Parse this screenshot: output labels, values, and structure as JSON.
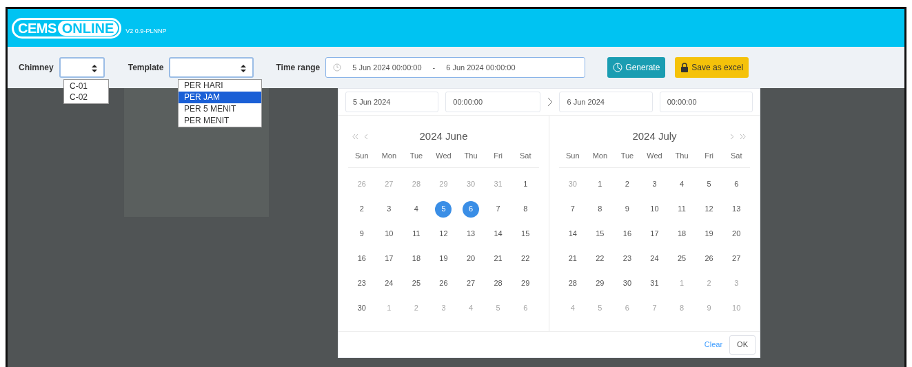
{
  "header": {
    "logo_left": "CEMS",
    "logo_right": "ONLINE",
    "version": "V2 0.9-PLNNP"
  },
  "toolbar": {
    "chimney": {
      "label": "Chimney",
      "options": [
        {
          "label": "C-01",
          "selected": false
        },
        {
          "label": "C-02",
          "selected": false
        }
      ]
    },
    "template": {
      "label": "Template",
      "options": [
        {
          "label": "PER HARI",
          "selected": false
        },
        {
          "label": "PER JAM",
          "selected": true
        },
        {
          "label": "PER 5 MENIT",
          "selected": false
        },
        {
          "label": "PER MENIT",
          "selected": false
        }
      ]
    },
    "time_range": {
      "label": "Time range",
      "start": "5 Jun 2024 00:00:00",
      "separator": "-",
      "end": "6 Jun 2024 00:00:00"
    },
    "buttons": [
      {
        "kind": "generate",
        "label": "Generate"
      },
      {
        "kind": "excel",
        "label": "Save as excel"
      }
    ]
  },
  "picker": {
    "start_date": "5 Jun 2024",
    "start_time": "00:00:00",
    "end_date": "6 Jun 2024",
    "end_time": "00:00:00",
    "months": [
      {
        "title": "2024 June",
        "prev_nav": true,
        "next_nav": false,
        "weekdays": [
          "Sun",
          "Mon",
          "Tue",
          "Wed",
          "Thu",
          "Fri",
          "Sat"
        ],
        "days": [
          {
            "label": "26",
            "muted": true,
            "selected": false
          },
          {
            "label": "27",
            "muted": true,
            "selected": false
          },
          {
            "label": "28",
            "muted": true,
            "selected": false
          },
          {
            "label": "29",
            "muted": true,
            "selected": false
          },
          {
            "label": "30",
            "muted": true,
            "selected": false
          },
          {
            "label": "31",
            "muted": true,
            "selected": false
          },
          {
            "label": "1",
            "muted": false,
            "selected": false
          },
          {
            "label": "2",
            "muted": false,
            "selected": false
          },
          {
            "label": "3",
            "muted": false,
            "selected": false
          },
          {
            "label": "4",
            "muted": false,
            "selected": false
          },
          {
            "label": "5",
            "muted": false,
            "selected": true
          },
          {
            "label": "6",
            "muted": false,
            "selected": true
          },
          {
            "label": "7",
            "muted": false,
            "selected": false
          },
          {
            "label": "8",
            "muted": false,
            "selected": false
          },
          {
            "label": "9",
            "muted": false,
            "selected": false
          },
          {
            "label": "10",
            "muted": false,
            "selected": false
          },
          {
            "label": "11",
            "muted": false,
            "selected": false
          },
          {
            "label": "12",
            "muted": false,
            "selected": false
          },
          {
            "label": "13",
            "muted": false,
            "selected": false
          },
          {
            "label": "14",
            "muted": false,
            "selected": false
          },
          {
            "label": "15",
            "muted": false,
            "selected": false
          },
          {
            "label": "16",
            "muted": false,
            "selected": false
          },
          {
            "label": "17",
            "muted": false,
            "selected": false
          },
          {
            "label": "18",
            "muted": false,
            "selected": false
          },
          {
            "label": "19",
            "muted": false,
            "selected": false
          },
          {
            "label": "20",
            "muted": false,
            "selected": false
          },
          {
            "label": "21",
            "muted": false,
            "selected": false
          },
          {
            "label": "22",
            "muted": false,
            "selected": false
          },
          {
            "label": "23",
            "muted": false,
            "selected": false
          },
          {
            "label": "24",
            "muted": false,
            "selected": false
          },
          {
            "label": "25",
            "muted": false,
            "selected": false
          },
          {
            "label": "26",
            "muted": false,
            "selected": false
          },
          {
            "label": "27",
            "muted": false,
            "selected": false
          },
          {
            "label": "28",
            "muted": false,
            "selected": false
          },
          {
            "label": "29",
            "muted": false,
            "selected": false
          },
          {
            "label": "30",
            "muted": false,
            "selected": false
          },
          {
            "label": "1",
            "muted": true,
            "selected": false
          },
          {
            "label": "2",
            "muted": true,
            "selected": false
          },
          {
            "label": "3",
            "muted": true,
            "selected": false
          },
          {
            "label": "4",
            "muted": true,
            "selected": false
          },
          {
            "label": "5",
            "muted": true,
            "selected": false
          },
          {
            "label": "6",
            "muted": true,
            "selected": false
          }
        ]
      },
      {
        "title": "2024 July",
        "prev_nav": false,
        "next_nav": true,
        "weekdays": [
          "Sun",
          "Mon",
          "Tue",
          "Wed",
          "Thu",
          "Fri",
          "Sat"
        ],
        "days": [
          {
            "label": "30",
            "muted": true,
            "selected": false
          },
          {
            "label": "1",
            "muted": false,
            "selected": false
          },
          {
            "label": "2",
            "muted": false,
            "selected": false
          },
          {
            "label": "3",
            "muted": false,
            "selected": false
          },
          {
            "label": "4",
            "muted": false,
            "selected": false
          },
          {
            "label": "5",
            "muted": false,
            "selected": false
          },
          {
            "label": "6",
            "muted": false,
            "selected": false
          },
          {
            "label": "7",
            "muted": false,
            "selected": false
          },
          {
            "label": "8",
            "muted": false,
            "selected": false
          },
          {
            "label": "9",
            "muted": false,
            "selected": false
          },
          {
            "label": "10",
            "muted": false,
            "selected": false
          },
          {
            "label": "11",
            "muted": false,
            "selected": false
          },
          {
            "label": "12",
            "muted": false,
            "selected": false
          },
          {
            "label": "13",
            "muted": false,
            "selected": false
          },
          {
            "label": "14",
            "muted": false,
            "selected": false
          },
          {
            "label": "15",
            "muted": false,
            "selected": false
          },
          {
            "label": "16",
            "muted": false,
            "selected": false
          },
          {
            "label": "17",
            "muted": false,
            "selected": false
          },
          {
            "label": "18",
            "muted": false,
            "selected": false
          },
          {
            "label": "19",
            "muted": false,
            "selected": false
          },
          {
            "label": "20",
            "muted": false,
            "selected": false
          },
          {
            "label": "21",
            "muted": false,
            "selected": false
          },
          {
            "label": "22",
            "muted": false,
            "selected": false
          },
          {
            "label": "23",
            "muted": false,
            "selected": false
          },
          {
            "label": "24",
            "muted": false,
            "selected": false
          },
          {
            "label": "25",
            "muted": false,
            "selected": false
          },
          {
            "label": "26",
            "muted": false,
            "selected": false
          },
          {
            "label": "27",
            "muted": false,
            "selected": false
          },
          {
            "label": "28",
            "muted": false,
            "selected": false
          },
          {
            "label": "29",
            "muted": false,
            "selected": false
          },
          {
            "label": "30",
            "muted": false,
            "selected": false
          },
          {
            "label": "31",
            "muted": false,
            "selected": false
          },
          {
            "label": "1",
            "muted": true,
            "selected": false
          },
          {
            "label": "2",
            "muted": true,
            "selected": false
          },
          {
            "label": "3",
            "muted": true,
            "selected": false
          },
          {
            "label": "4",
            "muted": true,
            "selected": false
          },
          {
            "label": "5",
            "muted": true,
            "selected": false
          },
          {
            "label": "6",
            "muted": true,
            "selected": false
          },
          {
            "label": "7",
            "muted": true,
            "selected": false
          },
          {
            "label": "8",
            "muted": true,
            "selected": false
          },
          {
            "label": "9",
            "muted": true,
            "selected": false
          },
          {
            "label": "10",
            "muted": true,
            "selected": false
          }
        ]
      }
    ],
    "footer": {
      "clear": "Clear",
      "ok": "OK"
    }
  }
}
